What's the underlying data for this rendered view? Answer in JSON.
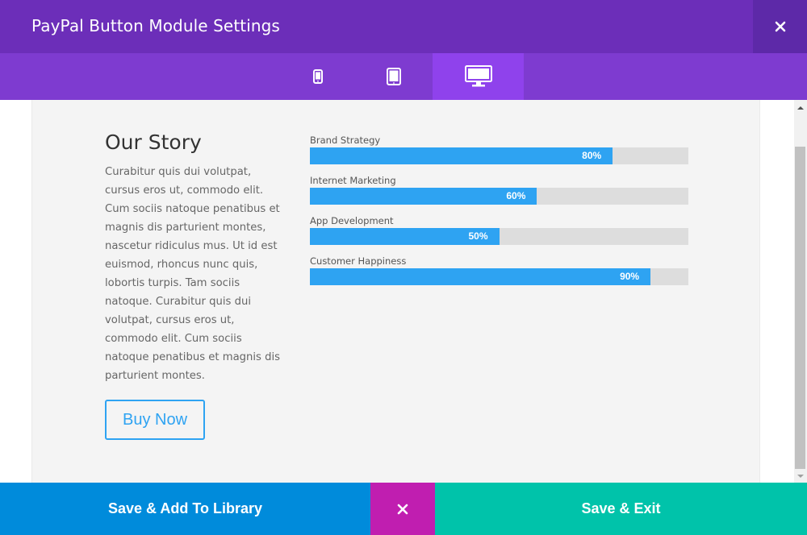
{
  "header": {
    "title": "PayPal Button Module Settings",
    "close_icon": "close-icon"
  },
  "device_tabs": [
    {
      "name": "phone",
      "icon": "phone-icon",
      "active": false
    },
    {
      "name": "tablet",
      "icon": "tablet-icon",
      "active": false
    },
    {
      "name": "desktop",
      "icon": "desktop-icon",
      "active": true
    }
  ],
  "preview": {
    "title": "Our Story",
    "body": "Curabitur quis dui volutpat, cursus eros ut, commodo elit. Cum sociis natoque penatibus et magnis dis parturient montes, nascetur ridiculus mus. Ut id est euismod, rhoncus nunc quis, lobortis turpis. Tam sociis natoque. Curabitur quis dui volutpat, cursus eros ut, commodo elit. Cum sociis natoque penatibus et magnis dis parturient montes.",
    "button_label": "Buy Now",
    "bars": [
      {
        "label": "Brand Strategy",
        "percent_text": "80%",
        "value": 80
      },
      {
        "label": "Internet Marketing",
        "percent_text": "60%",
        "value": 60
      },
      {
        "label": "App Development",
        "percent_text": "50%",
        "value": 50
      },
      {
        "label": "Customer Happiness",
        "percent_text": "90%",
        "value": 90
      }
    ]
  },
  "footer": {
    "save_library_label": "Save & Add To Library",
    "save_exit_label": "Save & Exit"
  },
  "colors": {
    "header_bg": "#6c2eb9",
    "device_bar_bg": "#7e3bd0",
    "active_tab_bg": "#8f42ec",
    "accent_blue": "#2ea3f2",
    "library_button": "#008bdb",
    "cancel_button": "#c01eb0",
    "exit_button": "#00c3aa"
  }
}
